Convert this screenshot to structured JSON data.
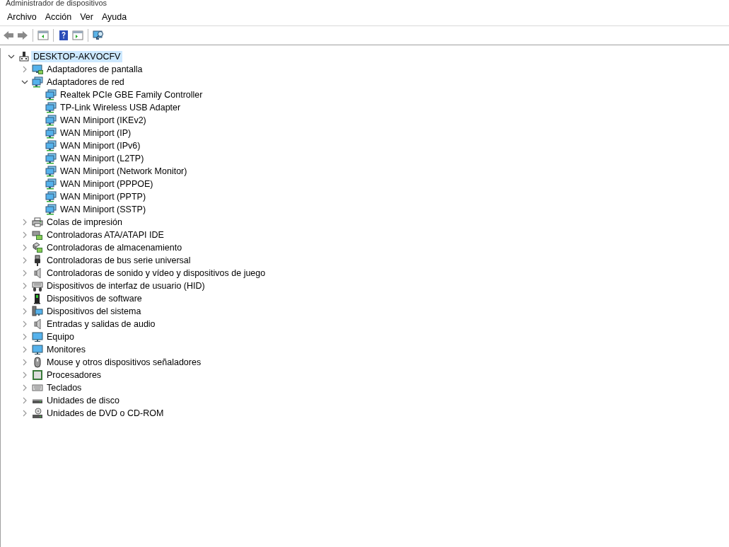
{
  "window": {
    "title": "Administrador de dispositivos"
  },
  "menu": [
    {
      "label": "Archivo"
    },
    {
      "label": "Acción"
    },
    {
      "label": "Ver"
    },
    {
      "label": "Ayuda"
    }
  ],
  "toolbar": [
    {
      "kind": "back",
      "disabled": false
    },
    {
      "kind": "forward",
      "disabled": false
    },
    {
      "kind": "sep"
    },
    {
      "kind": "properties"
    },
    {
      "kind": "sep"
    },
    {
      "kind": "help"
    },
    {
      "kind": "pane"
    },
    {
      "kind": "sep"
    },
    {
      "kind": "scan"
    }
  ],
  "tree": {
    "label": "DESKTOP-AKVOCFV",
    "kind": "computer-root",
    "expanded": true,
    "selected": true,
    "children": [
      {
        "label": "Adaptadores de pantalla",
        "kind": "display",
        "expanded": false,
        "selected": false
      },
      {
        "label": "Adaptadores de red",
        "kind": "network",
        "expanded": true,
        "selected": false,
        "children": [
          {
            "label": "Realtek PCIe GBE Family Controller",
            "kind": "network",
            "selected": false
          },
          {
            "label": "TP-Link Wireless USB Adapter",
            "kind": "network",
            "selected": false
          },
          {
            "label": "WAN Miniport (IKEv2)",
            "kind": "network",
            "selected": false
          },
          {
            "label": "WAN Miniport (IP)",
            "kind": "network",
            "selected": false
          },
          {
            "label": "WAN Miniport (IPv6)",
            "kind": "network",
            "selected": false
          },
          {
            "label": "WAN Miniport (L2TP)",
            "kind": "network",
            "selected": false
          },
          {
            "label": "WAN Miniport (Network Monitor)",
            "kind": "network",
            "selected": false
          },
          {
            "label": "WAN Miniport (PPPOE)",
            "kind": "network",
            "selected": false
          },
          {
            "label": "WAN Miniport (PPTP)",
            "kind": "network",
            "selected": false
          },
          {
            "label": "WAN Miniport (SSTP)",
            "kind": "network",
            "selected": false
          }
        ]
      },
      {
        "label": "Colas de impresión",
        "kind": "printer",
        "expanded": false,
        "selected": false
      },
      {
        "label": "Controladoras ATA/ATAPI IDE",
        "kind": "ide",
        "expanded": false,
        "selected": false
      },
      {
        "label": "Controladoras de almacenamiento",
        "kind": "storage",
        "expanded": false,
        "selected": false
      },
      {
        "label": "Controladoras de bus serie universal",
        "kind": "usb",
        "expanded": false,
        "selected": false
      },
      {
        "label": "Controladoras de sonido y vídeo y dispositivos de juego",
        "kind": "speaker",
        "expanded": false,
        "selected": false
      },
      {
        "label": "Dispositivos de interfaz de usuario (HID)",
        "kind": "hid",
        "expanded": false,
        "selected": false
      },
      {
        "label": "Dispositivos de software",
        "kind": "software",
        "expanded": false,
        "selected": false
      },
      {
        "label": "Dispositivos del sistema",
        "kind": "system",
        "expanded": false,
        "selected": false
      },
      {
        "label": "Entradas y salidas de audio",
        "kind": "speaker",
        "expanded": false,
        "selected": false
      },
      {
        "label": "Equipo",
        "kind": "monitor",
        "expanded": false,
        "selected": false
      },
      {
        "label": "Monitores",
        "kind": "monitor",
        "expanded": false,
        "selected": false
      },
      {
        "label": "Mouse y otros dispositivos señaladores",
        "kind": "mouse",
        "expanded": false,
        "selected": false
      },
      {
        "label": "Procesadores",
        "kind": "cpu",
        "expanded": false,
        "selected": false
      },
      {
        "label": "Teclados",
        "kind": "keyboard",
        "expanded": false,
        "selected": false
      },
      {
        "label": "Unidades de disco",
        "kind": "disk",
        "expanded": false,
        "selected": false
      },
      {
        "label": "Unidades de DVD o CD-ROM",
        "kind": "dvd",
        "expanded": false,
        "selected": false
      }
    ]
  }
}
